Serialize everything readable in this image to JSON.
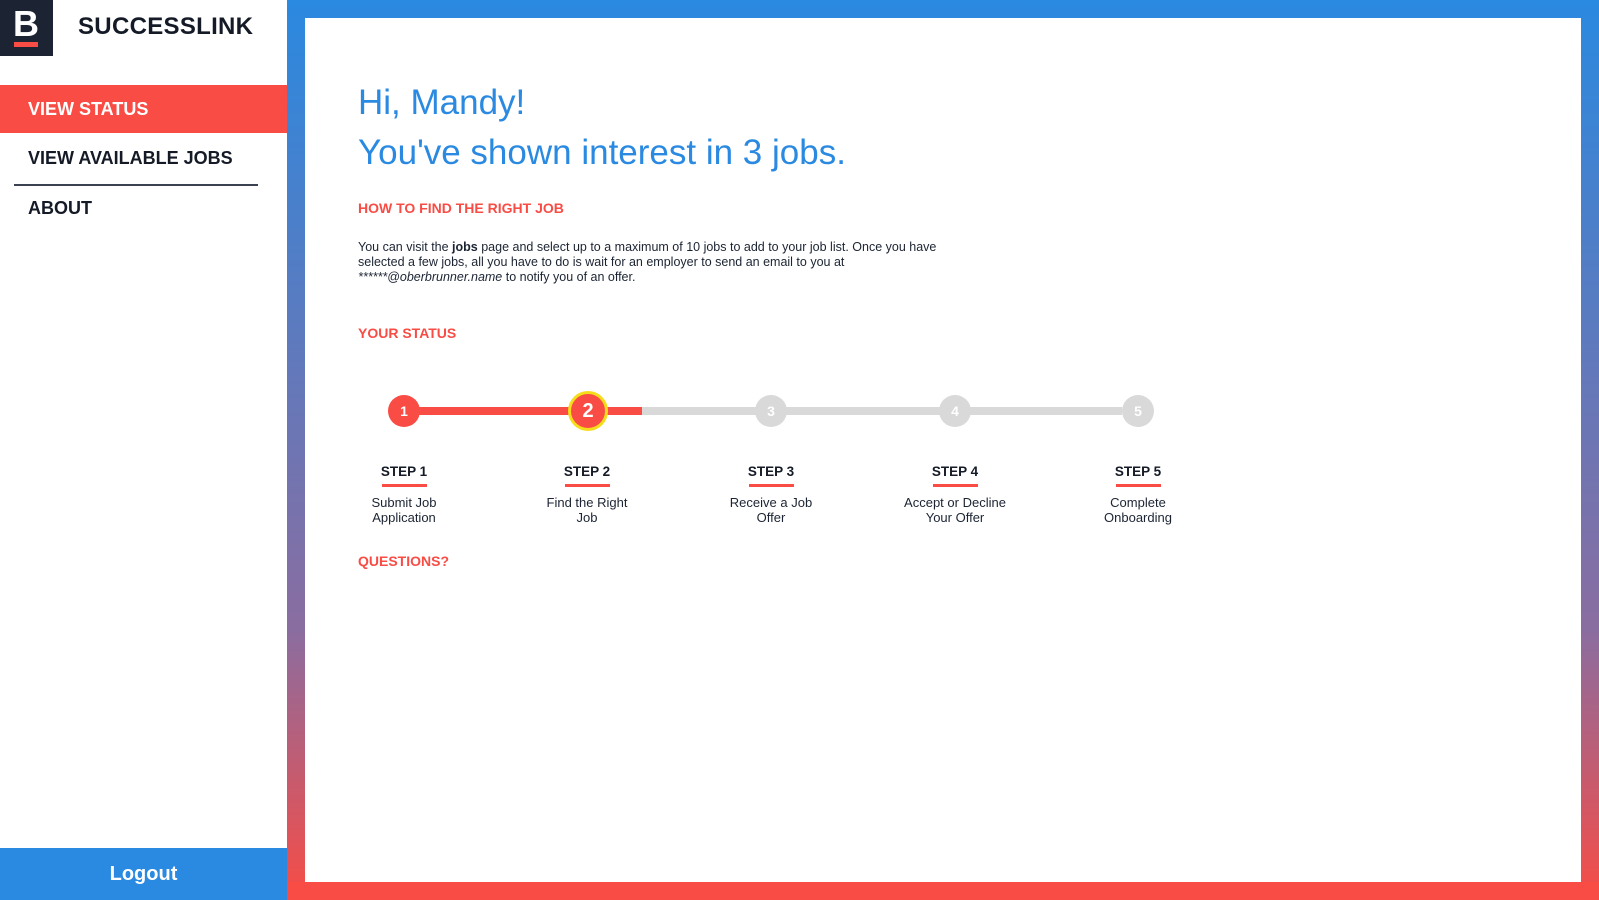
{
  "brand": {
    "logo_letter": "B",
    "name": "SUCCESSLINK"
  },
  "nav": {
    "items": [
      {
        "label": "VIEW STATUS",
        "active": true
      },
      {
        "label": "VIEW AVAILABLE JOBS",
        "active": false
      },
      {
        "label": "ABOUT",
        "active": false
      }
    ],
    "logout_label": "Logout"
  },
  "main": {
    "greeting_line1": "Hi, Mandy!",
    "greeting_line2": "You've shown interest in 3 jobs.",
    "how_to_title": "HOW TO FIND THE RIGHT JOB",
    "how_to_text": {
      "part1": "You can visit the ",
      "bold": "jobs",
      "part2": " page and select up to a maximum of 10 jobs to add to your job list. Once you have selected a few jobs, all you have to do is wait for an employer to send an email to you at ",
      "email": "******@oberbrunner.name",
      "part3": " to notify you of an offer."
    },
    "status_title": "YOUR STATUS",
    "current_step": 2,
    "steps": [
      {
        "number": "1",
        "label": "STEP 1",
        "desc_line1": "Submit Job",
        "desc_line2": "Application"
      },
      {
        "number": "2",
        "label": "STEP 2",
        "desc_line1": "Find the Right",
        "desc_line2": "Job"
      },
      {
        "number": "3",
        "label": "STEP 3",
        "desc_line1": "Receive a Job",
        "desc_line2": "Offer"
      },
      {
        "number": "4",
        "label": "STEP 4",
        "desc_line1": "Accept or Decline",
        "desc_line2": "Your Offer"
      },
      {
        "number": "5",
        "label": "STEP 5",
        "desc_line1": "Complete",
        "desc_line2": "Onboarding"
      }
    ],
    "questions_title": "QUESTIONS?"
  },
  "colors": {
    "accent_red": "#f84c45",
    "accent_blue": "#2a89e0",
    "current_ring": "#f5dd1b",
    "inactive_gray": "#d9d9d9",
    "dark_navy": "#141a26"
  }
}
